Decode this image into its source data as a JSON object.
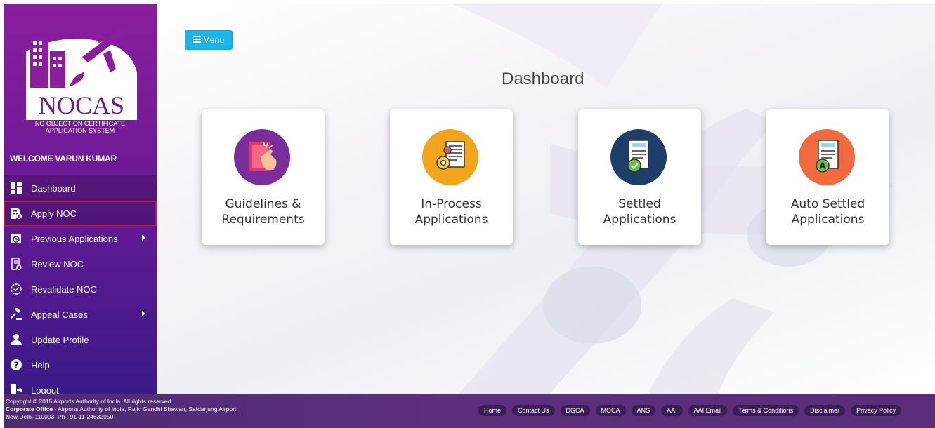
{
  "app": {
    "logo_text": "NOCAS",
    "logo_subtitle_line1": "NO OBJECTION CERTIFICATE",
    "logo_subtitle_line2": "APPLICATION SYSTEM",
    "welcome": "WELCOME VARUN KUMAR"
  },
  "sidebar": {
    "items": [
      {
        "label": "Dashboard",
        "icon": "dashboard-icon"
      },
      {
        "label": "Apply NOC",
        "icon": "apply-icon"
      },
      {
        "label": "Previous Applications",
        "icon": "history-icon"
      },
      {
        "label": "Review NOC",
        "icon": "review-icon"
      },
      {
        "label": "Revalidate NOC",
        "icon": "revalidate-icon"
      },
      {
        "label": "Appeal Cases",
        "icon": "gavel-icon"
      },
      {
        "label": "Update Profile",
        "icon": "user-icon"
      },
      {
        "label": "Help",
        "icon": "help-icon"
      },
      {
        "label": "Logout",
        "icon": "logout-icon"
      }
    ]
  },
  "main": {
    "menu_label": "Menu",
    "title": "Dashboard",
    "cards": [
      {
        "line1": "Guidelines &",
        "line2": "Requirements",
        "icon": "guidelines-icon",
        "color": "#7b2d9b"
      },
      {
        "line1": "In-Process",
        "line2": "Applications",
        "icon": "in-process-icon",
        "color": "#f2a51b"
      },
      {
        "line1": "Settled",
        "line2": "Applications",
        "icon": "settled-icon",
        "color": "#1d3d6b"
      },
      {
        "line1": "Auto Settled",
        "line2": "Applications",
        "icon": "auto-settled-icon",
        "color": "#f26a3d"
      }
    ]
  },
  "footer": {
    "copyright": "Copyright © 2015 Airports Authority of India. All rights reserved",
    "office_label": "Corporate Office",
    "office_text": " - Airports Authority of India, Rajiv Gandhi Bhawan, Safdarjung Airport,",
    "address": "New Delhi-110003, Ph : 91-11-24632950",
    "links": [
      "Home",
      "Contact Us",
      "DGCA",
      "MOCA",
      "ANS",
      "AAI",
      "AAI Email",
      "Terms & Conditions",
      "Disclaimer",
      "Privacy Policy"
    ]
  },
  "colors": {
    "sidebar_top": "#8a1e9e",
    "sidebar_bottom": "#3a1a88",
    "menu_button": "#1ab6ea",
    "footer": "#5a2d7a",
    "highlight_border": "#e0101c"
  }
}
